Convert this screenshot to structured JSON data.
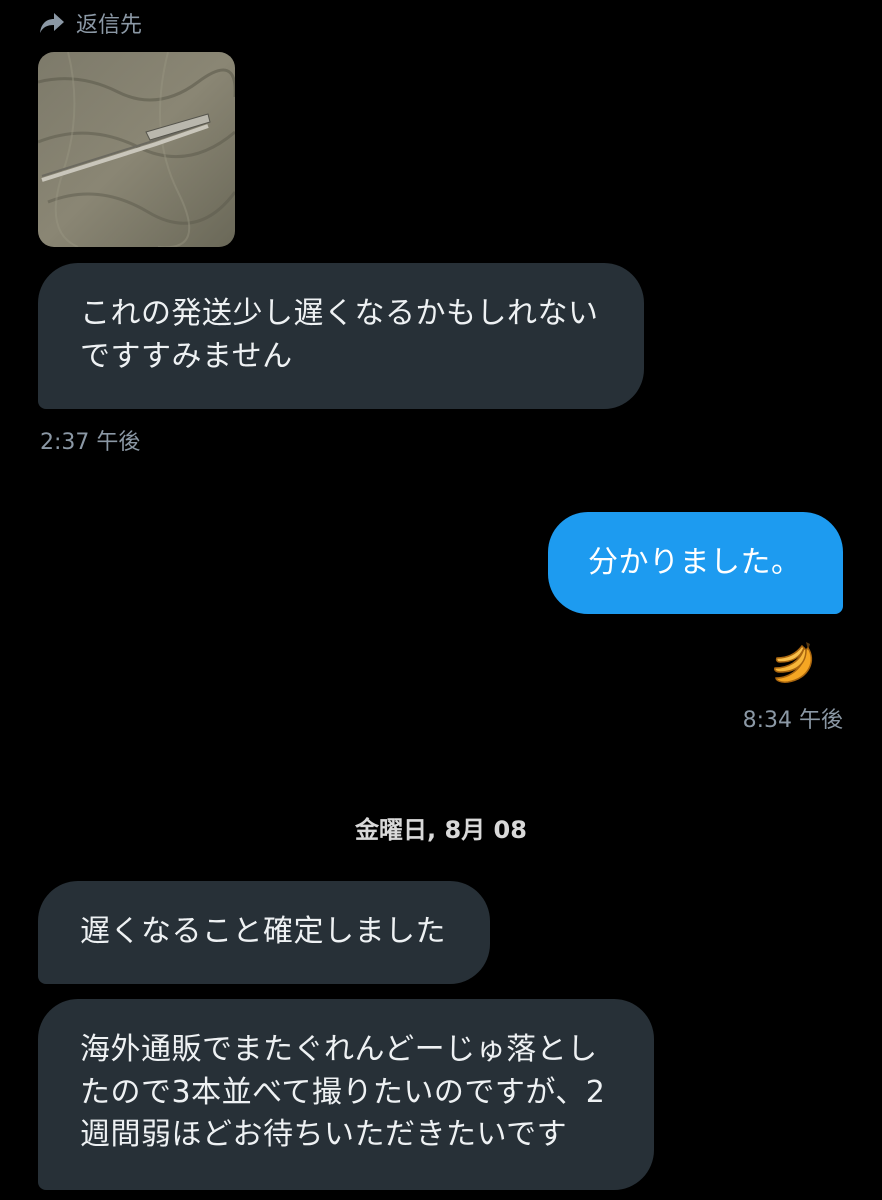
{
  "reply_header": {
    "label": "返信先",
    "icon": "reply-arrow-icon"
  },
  "messages": [
    {
      "direction": "incoming",
      "text": "これの発送少し遅くなるかもしれない\nですすみません",
      "timestamp": "2:37 午後"
    },
    {
      "direction": "outgoing",
      "text": "分かりました。",
      "reaction": "banana-emoji",
      "timestamp": "8:34 午後"
    }
  ],
  "date_divider": "金曜日, 8月 08",
  "later_messages": [
    {
      "direction": "incoming",
      "text": "遅くなること確定しました"
    },
    {
      "direction": "incoming",
      "text": "海外通販でまたぐれんどーじゅ落とし\nたので3本並べて撮りたいのですが、2\n週間弱ほどお待ちいただきたいです"
    }
  ],
  "colors": {
    "background": "#000000",
    "incoming_bubble": "#273037",
    "outgoing_bubble": "#1d9bf0",
    "secondary_text": "#8b98a5"
  }
}
